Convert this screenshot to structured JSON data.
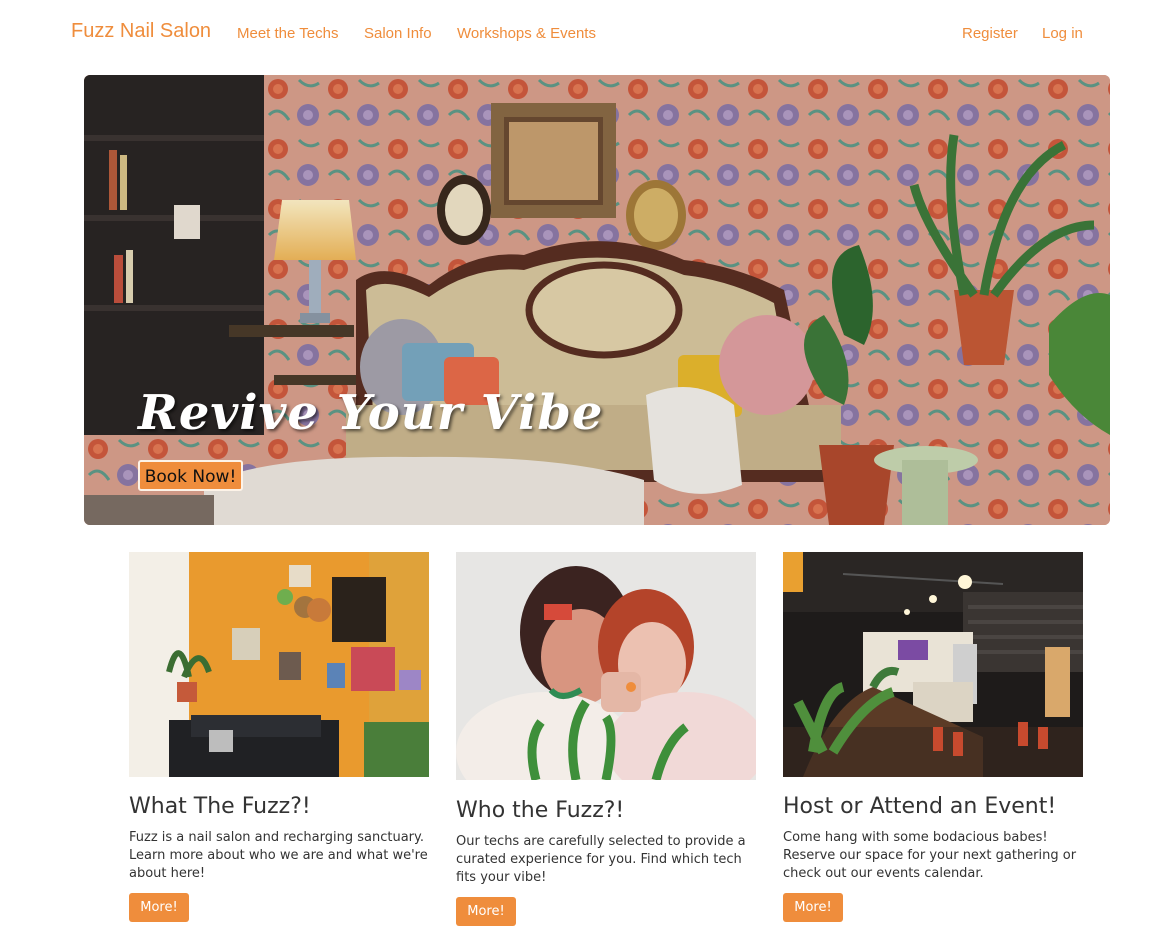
{
  "colors": {
    "brand": "#ef8d3c",
    "button": "#ef8d3c",
    "text": "#333333"
  },
  "nav": {
    "brand": "Fuzz Nail Salon",
    "links": [
      "Meet the Techs",
      "Salon Info",
      "Workshops & Events"
    ],
    "register": "Register",
    "login": "Log in"
  },
  "hero": {
    "title": "Revive Your Vibe",
    "button": "Book Now!"
  },
  "cards": [
    {
      "title": "What The Fuzz?!",
      "text": "Fuzz is a nail salon and recharging sanctuary. Learn more about who we are and what we're about here!",
      "button": "More!"
    },
    {
      "title": "Who the Fuzz?!",
      "text": "Our techs are carefully selected to provide a curated experience for you. Find which tech fits your vibe!",
      "button": "More!"
    },
    {
      "title": "Host or Attend an Event!",
      "text": "Come hang with some bodacious babes! Reserve our space for your next gathering or check out our events calendar.",
      "button": "More!"
    }
  ]
}
